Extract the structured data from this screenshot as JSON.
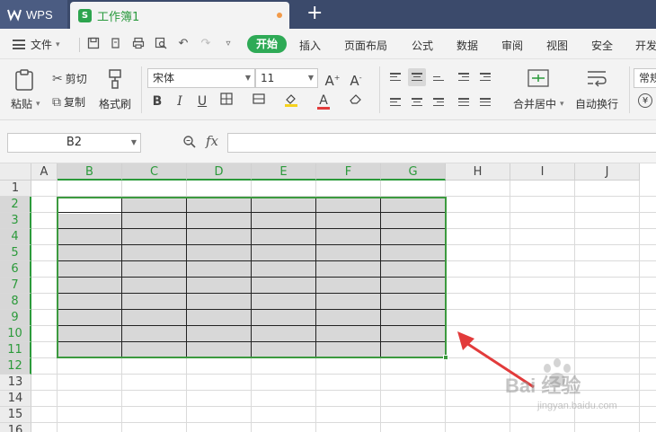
{
  "titlebar": {
    "app_name": "WPS",
    "doc_name": "工作簿1",
    "new_tab": "+"
  },
  "menu": {
    "file": "文件",
    "home": "开始",
    "items": [
      "插入",
      "页面布局",
      "公式",
      "数据",
      "审阅",
      "视图",
      "安全",
      "开发"
    ]
  },
  "ribbon": {
    "paste": "粘贴",
    "cut": "剪切",
    "copy": "复制",
    "format_painter": "格式刷",
    "font_name": "宋体",
    "font_size": "11",
    "merge_center": "合并居中",
    "wrap_text": "自动换行",
    "number_format": "常规"
  },
  "formula_bar": {
    "name_box": "B2",
    "fx": "fx",
    "value": ""
  },
  "sheet": {
    "columns": [
      "A",
      "B",
      "C",
      "D",
      "E",
      "F",
      "G",
      "H",
      "I",
      "J"
    ],
    "rows": [
      "1",
      "2",
      "3",
      "4",
      "5",
      "6",
      "7",
      "8",
      "9",
      "10",
      "11",
      "12",
      "13",
      "14",
      "15",
      "16"
    ],
    "selected_range": "B2:G12",
    "active_cell": "B2"
  },
  "watermark": {
    "main": "Bai 经验",
    "sub": "jingyan.baidu.com"
  },
  "colors": {
    "accent": "#2eaa56",
    "title_bg": "#3b4a6b",
    "selection": "#3c9a3f",
    "arrow": "#e23b3b"
  }
}
